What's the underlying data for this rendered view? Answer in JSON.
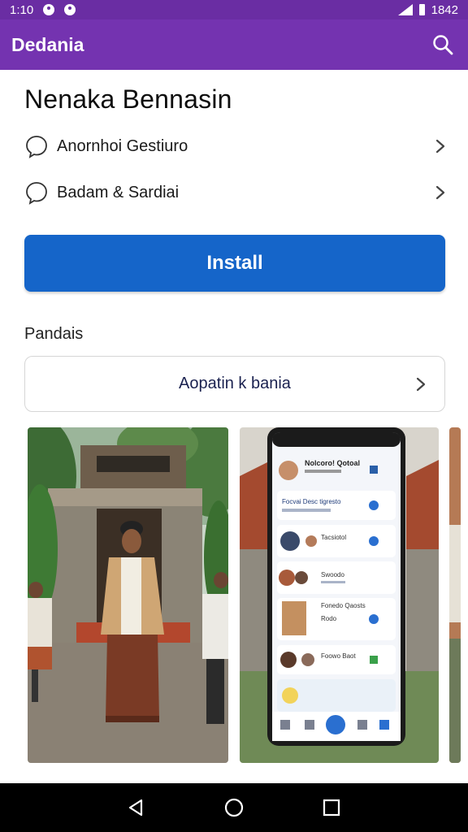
{
  "status_bar": {
    "time": "1:10",
    "right_text": "1842"
  },
  "app_bar": {
    "title": "Dedania",
    "search_icon": "search-icon"
  },
  "page": {
    "title": "Nenaka Bennasin"
  },
  "list_items": [
    {
      "label": "Anornhoi Gestiuro",
      "icon": "chat-bubble-icon"
    },
    {
      "label": "Badam & Sardiai",
      "icon": "chat-bubble-icon"
    }
  ],
  "install": {
    "label": "Install",
    "color": "#1565c9"
  },
  "section": {
    "label": "Pandais"
  },
  "outline_row": {
    "label": "Aopatin k bania"
  },
  "screenshots": {
    "phone": {
      "header": "Nolcoro! Qotoal",
      "rows": [
        "Focvai Desc tigresto",
        "Tacsiotol",
        "Swoodo",
        "Fonedo Qaosts",
        "Foowo Baot"
      ],
      "sub": "Rodo"
    }
  },
  "colors": {
    "status_bar": "#6a2da3",
    "app_bar": "#7433b0",
    "accent": "#1565c9"
  }
}
